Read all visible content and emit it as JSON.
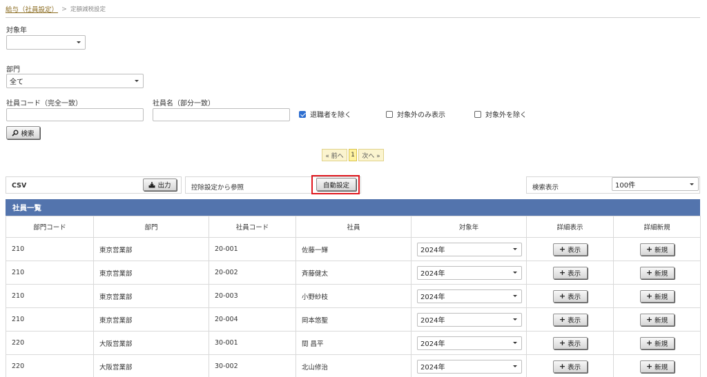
{
  "breadcrumb": {
    "parent": "給与（社員設定）",
    "separator": ">",
    "current": "定額減税設定"
  },
  "filters": {
    "year_label": "対象年",
    "year_value": "",
    "dept_label": "部門",
    "dept_value": "全て",
    "emp_code_label": "社員コード（完全一致）",
    "emp_code_value": "",
    "emp_name_label": "社員名（部分一致）",
    "emp_name_value": "",
    "exclude_retired_label": "退職者を除く",
    "exclude_retired_checked": true,
    "only_excluded_label": "対象外のみ表示",
    "only_excluded_checked": false,
    "exclude_excluded_label": "対象外を除く",
    "exclude_excluded_checked": false,
    "search_button": "検索",
    "search_icon": "search-icon"
  },
  "pager": {
    "prev": "« 前へ",
    "page": "1",
    "next": "次へ »"
  },
  "toolbar": {
    "csv_label": "CSV",
    "export_button": "出力",
    "export_icon": "download-icon",
    "deduction_label": "控除設定から参照",
    "auto_button": "自動設定",
    "display_label": "検索表示",
    "display_value": "100件"
  },
  "list": {
    "title": "社員一覧",
    "columns": [
      "部門コード",
      "部門",
      "社員コード",
      "社員",
      "対象年",
      "詳細表示",
      "詳細新規"
    ],
    "view_button": "表示",
    "new_button": "新規",
    "rows": [
      {
        "dept_code": "210",
        "dept": "東京営業部",
        "emp_code": "20-001",
        "emp": "佐藤一輝",
        "year": "2024年"
      },
      {
        "dept_code": "210",
        "dept": "東京営業部",
        "emp_code": "20-002",
        "emp": "斉藤健太",
        "year": "2024年"
      },
      {
        "dept_code": "210",
        "dept": "東京営業部",
        "emp_code": "20-003",
        "emp": "小野紗枝",
        "year": "2024年"
      },
      {
        "dept_code": "210",
        "dept": "東京営業部",
        "emp_code": "20-004",
        "emp": "岡本悠聖",
        "year": "2024年"
      },
      {
        "dept_code": "220",
        "dept": "大阪営業部",
        "emp_code": "30-001",
        "emp": "間 昌平",
        "year": "2024年"
      },
      {
        "dept_code": "220",
        "dept": "大阪営業部",
        "emp_code": "30-002",
        "emp": "北山修治",
        "year": "2024年"
      }
    ]
  },
  "colors": {
    "list_header": "#5374ad",
    "highlight_frame": "#e0161d",
    "pager_bg": "#fbf4cf"
  }
}
